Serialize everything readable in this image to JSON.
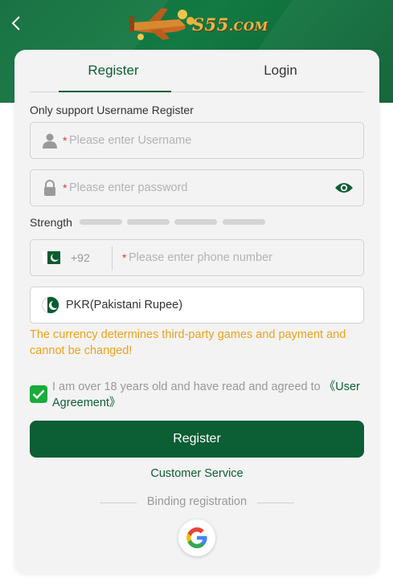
{
  "header": {
    "logo_text_main": "S55",
    "logo_text_suffix": ".COM",
    "back_icon": "chevron-left-icon"
  },
  "tabs": [
    {
      "label": "Register",
      "active": true
    },
    {
      "label": "Login",
      "active": false
    }
  ],
  "form": {
    "hint": "Only support Username Register",
    "username": {
      "required_mark": "*",
      "placeholder": "Please enter Username",
      "icon": "user-icon"
    },
    "password": {
      "required_mark": "*",
      "placeholder": "Please enter password",
      "icon": "lock-icon",
      "toggle_icon": "eye-icon"
    },
    "strength": {
      "label": "Strength",
      "level": 0,
      "segments": 4
    },
    "phone": {
      "country_code": "+92",
      "required_mark": "*",
      "placeholder": "Please enter phone number",
      "flag": "pakistan-flag-icon"
    },
    "currency": {
      "value": "PKR(Pakistani Rupee)",
      "flag": "pakistan-flag-icon"
    },
    "currency_warning": "The currency determines third-party games and payment and cannot be changed!",
    "agreement": {
      "checked": true,
      "text": "I am over 18 years old and have read and agreed to ",
      "link": "《User Agreement》"
    },
    "register_button": "Register"
  },
  "customer_service": "Customer Service",
  "binding": {
    "label": "Binding registration",
    "google_icon": "google-icon"
  },
  "colors": {
    "brand": "#0c5e34",
    "warning": "#f0a11a",
    "check": "#1aac3a",
    "required": "#e03a3a"
  }
}
